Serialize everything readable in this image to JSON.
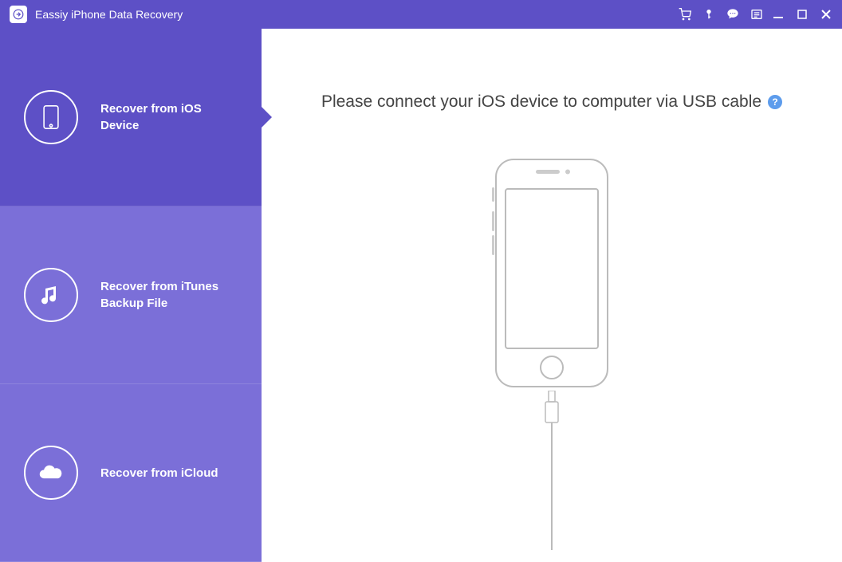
{
  "titlebar": {
    "title": "Eassiy iPhone Data Recovery"
  },
  "sidebar": {
    "items": [
      {
        "label": "Recover from iOS Device",
        "icon": "phone-icon",
        "active": true
      },
      {
        "label": "Recover from iTunes Backup File",
        "icon": "music-icon",
        "active": false
      },
      {
        "label": "Recover from iCloud",
        "icon": "cloud-icon",
        "active": false
      }
    ]
  },
  "content": {
    "heading": "Please connect your iOS device to computer via USB cable",
    "help_tooltip": "?"
  }
}
